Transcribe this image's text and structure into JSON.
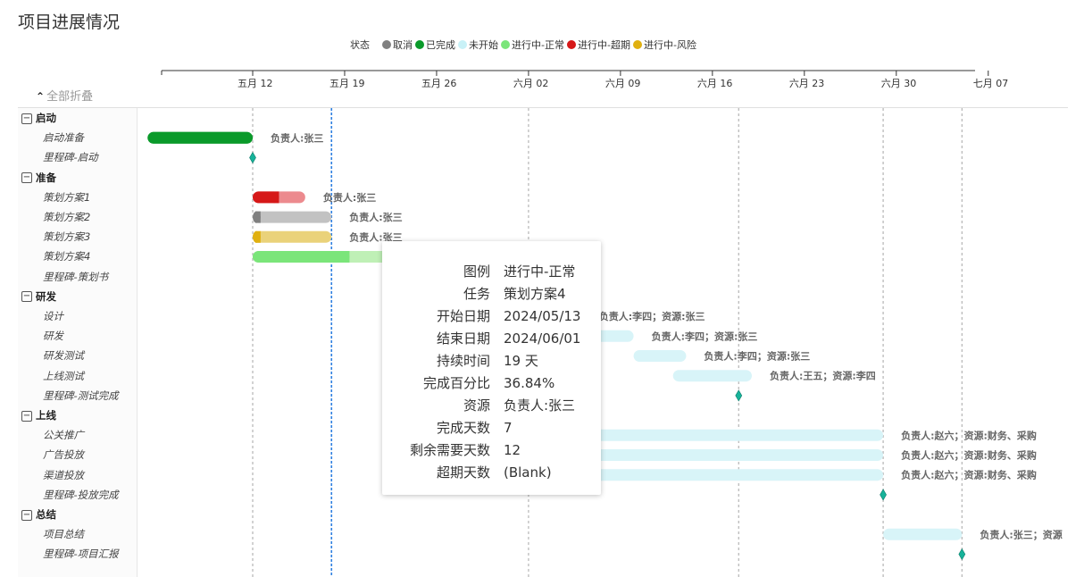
{
  "page": {
    "title": "项目进展情况"
  },
  "legend": {
    "title": "状态",
    "items": [
      {
        "label": "取消",
        "color": "#808080"
      },
      {
        "label": "已完成",
        "color": "#0a9a2a"
      },
      {
        "label": "未开始",
        "color": "#c8f1f7"
      },
      {
        "label": "进行中-正常",
        "color": "#7be57a"
      },
      {
        "label": "进行中-超期",
        "color": "#d61818"
      },
      {
        "label": "进行中-风险",
        "color": "#e0b010"
      }
    ]
  },
  "collapse_all": {
    "icon": "chevron-up-icon",
    "label": "全部折叠"
  },
  "timeline": {
    "ticks": [
      {
        "label": "五月 12",
        "date": "2024-05-12"
      },
      {
        "label": "五月 19",
        "date": "2024-05-19"
      },
      {
        "label": "五月 26",
        "date": "2024-05-26"
      },
      {
        "label": "六月 02",
        "date": "2024-06-02"
      },
      {
        "label": "六月 09",
        "date": "2024-06-09"
      },
      {
        "label": "六月 16",
        "date": "2024-06-16"
      },
      {
        "label": "六月 23",
        "date": "2024-06-23"
      },
      {
        "label": "六月 30",
        "date": "2024-06-30"
      },
      {
        "label": "七月 07",
        "date": "2024-07-07"
      }
    ],
    "today": "2024-05-18",
    "milestone_lines": [
      "2024-05-12",
      "2024-06-02",
      "2024-06-18",
      "2024-06-29",
      "2024-07-05"
    ]
  },
  "rows": [
    {
      "name": "启动",
      "kind": "group",
      "toggle": "−"
    },
    {
      "name": "启动准备",
      "kind": "task",
      "start": "2024-05-04",
      "end": "2024-05-12",
      "progress": 1.0,
      "status": "已完成",
      "label": "负责人:张三"
    },
    {
      "name": "里程碑-启动",
      "kind": "milestone",
      "date": "2024-05-12"
    },
    {
      "name": "准备",
      "kind": "group",
      "toggle": "−"
    },
    {
      "name": "策划方案1",
      "kind": "task",
      "start": "2024-05-12",
      "end": "2024-05-16",
      "progress": 0.5,
      "status": "进行中-超期",
      "label": "负责人:张三"
    },
    {
      "name": "策划方案2",
      "kind": "task",
      "start": "2024-05-12",
      "end": "2024-05-18",
      "progress": 0.1,
      "status": "取消",
      "label": "负责人:张三"
    },
    {
      "name": "策划方案3",
      "kind": "task",
      "start": "2024-05-12",
      "end": "2024-05-18",
      "progress": 0.1,
      "status": "进行中-风险",
      "label": "负责人:张三"
    },
    {
      "name": "策划方案4",
      "kind": "task",
      "start": "2024-05-12",
      "end": "2024-06-01",
      "progress": 0.3684,
      "status": "进行中-正常",
      "label": ""
    },
    {
      "name": "里程碑-策划书",
      "kind": "milestone",
      "date": "2024-06-02"
    },
    {
      "name": "研发",
      "kind": "group",
      "toggle": "−"
    },
    {
      "name": "设计",
      "kind": "task",
      "start": "2024-05-31",
      "end": "2024-06-06",
      "progress": 0,
      "status": "未开始",
      "label": "负责人:李四；资源:张三"
    },
    {
      "name": "研发",
      "kind": "task",
      "start": "2024-06-04",
      "end": "2024-06-10",
      "progress": 0,
      "status": "未开始",
      "label": "负责人:李四；资源:张三"
    },
    {
      "name": "研发测试",
      "kind": "task",
      "start": "2024-06-10",
      "end": "2024-06-14",
      "progress": 0,
      "status": "未开始",
      "label": "负责人:李四；资源:张三"
    },
    {
      "name": "上线测试",
      "kind": "task",
      "start": "2024-06-13",
      "end": "2024-06-19",
      "progress": 0,
      "status": "未开始",
      "label": "负责人:王五；资源:李四"
    },
    {
      "name": "里程碑-测试完成",
      "kind": "milestone",
      "date": "2024-06-18"
    },
    {
      "name": "上线",
      "kind": "group",
      "toggle": "−"
    },
    {
      "name": "公关推广",
      "kind": "task",
      "start": "2024-06-02",
      "end": "2024-06-29",
      "progress": 0,
      "status": "未开始",
      "label": "负责人:赵六；资源:财务、采购"
    },
    {
      "name": "广告投放",
      "kind": "task",
      "start": "2024-06-02",
      "end": "2024-06-29",
      "progress": 0,
      "status": "未开始",
      "label": "负责人:赵六；资源:财务、采购"
    },
    {
      "name": "渠道投放",
      "kind": "task",
      "start": "2024-06-02",
      "end": "2024-06-29",
      "progress": 0,
      "status": "未开始",
      "label": "负责人:赵六；资源:财务、采购"
    },
    {
      "name": "里程碑-投放完成",
      "kind": "milestone",
      "date": "2024-06-29"
    },
    {
      "name": "总结",
      "kind": "group",
      "toggle": "−"
    },
    {
      "name": "项目总结",
      "kind": "task",
      "start": "2024-06-29",
      "end": "2024-07-05",
      "progress": 0,
      "status": "未开始",
      "label": "负责人:张三；资源"
    },
    {
      "name": "里程碑-项目汇报",
      "kind": "milestone",
      "date": "2024-07-05"
    }
  ],
  "tooltip": {
    "fields": [
      {
        "label": "图例",
        "value": "进行中-正常"
      },
      {
        "label": "任务",
        "value": "策划方案4"
      },
      {
        "label": "开始日期",
        "value": "2024/05/13"
      },
      {
        "label": "结束日期",
        "value": "2024/06/01"
      },
      {
        "label": "持续时间",
        "value": "19 天"
      },
      {
        "label": "完成百分比",
        "value": "36.84%"
      },
      {
        "label": "资源",
        "value": "负责人:张三"
      },
      {
        "label": "完成天数",
        "value": "7"
      },
      {
        "label": "剩余需要天数",
        "value": "12"
      },
      {
        "label": "超期天数",
        "value": "(Blank)"
      }
    ]
  }
}
